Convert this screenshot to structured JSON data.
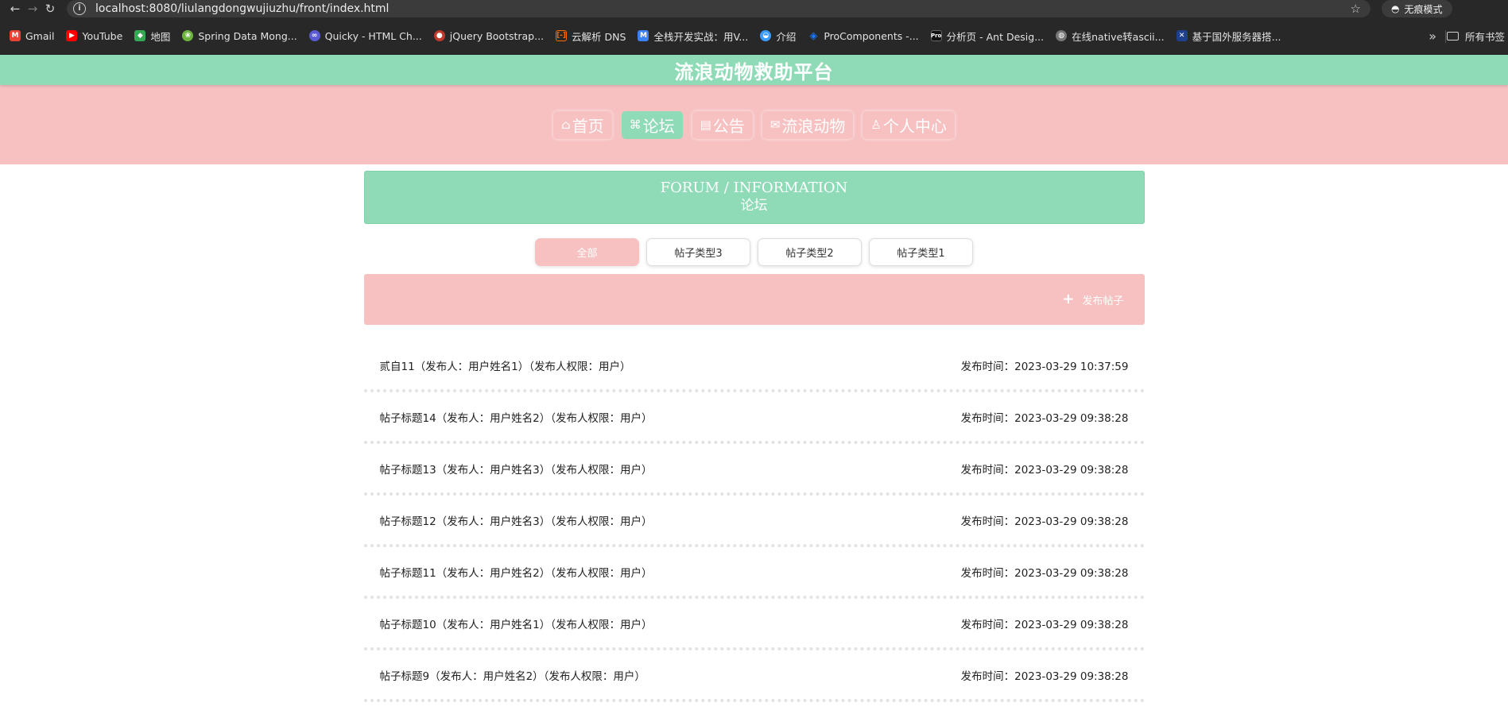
{
  "browser": {
    "url": "localhost:8080/liulangdongwujiuzhu/front/index.html",
    "mode_label": "无痕模式",
    "bookmarks": [
      {
        "label": "Gmail",
        "icon": "gmail-icon",
        "color": "#ea4335"
      },
      {
        "label": "YouTube",
        "icon": "youtube-icon",
        "color": "#ff0000"
      },
      {
        "label": "地图",
        "icon": "maps-icon",
        "color": "#34a853"
      },
      {
        "label": "Spring Data Mong...",
        "icon": "spring-icon",
        "color": "#6db33f"
      },
      {
        "label": "Quicky - HTML Ch...",
        "icon": "quicky-icon",
        "color": "#5b5bd6"
      },
      {
        "label": "jQuery Bootstrap...",
        "icon": "jquery-icon",
        "color": "#c0392b"
      },
      {
        "label": "云解析 DNS",
        "icon": "cloud-dns-icon",
        "color": "#ff6a00"
      },
      {
        "label": "全栈开发实战：用V...",
        "icon": "medium-icon",
        "color": "#3b82f6"
      },
      {
        "label": "介绍",
        "icon": "intro-icon",
        "color": "#3b9cff"
      },
      {
        "label": "ProComponents -...",
        "icon": "antd-icon",
        "color": "#1677ff"
      },
      {
        "label": "分析页 - Ant Desig...",
        "icon": "pro-icon",
        "color": "#111111"
      },
      {
        "label": "在线native转ascii...",
        "icon": "globe-icon",
        "color": "#777777"
      },
      {
        "label": "基于国外服务器搭...",
        "icon": "flag-icon",
        "color": "#1f3f8f"
      }
    ],
    "more_label": "»",
    "folder_label": "所有书签"
  },
  "site": {
    "title": "流浪动物救助平台",
    "nav": [
      {
        "label": "首页",
        "icon": "home-icon",
        "glyph": "⌂",
        "active": false
      },
      {
        "label": "论坛",
        "icon": "forum-icon",
        "glyph": "⌘",
        "active": true
      },
      {
        "label": "公告",
        "icon": "notice-icon",
        "glyph": "▤",
        "active": false
      },
      {
        "label": "流浪动物",
        "icon": "mail-icon",
        "glyph": "✉",
        "active": false
      },
      {
        "label": "个人中心",
        "icon": "user-icon",
        "glyph": "♙",
        "active": false
      }
    ]
  },
  "section": {
    "title_en": "FORUM / INFORMATION",
    "title_cn": "论坛"
  },
  "categories": [
    {
      "label": "全部",
      "active": true
    },
    {
      "label": "帖子类型3",
      "active": false
    },
    {
      "label": "帖子类型2",
      "active": false
    },
    {
      "label": "帖子类型1",
      "active": false
    }
  ],
  "actions": {
    "publish_label": "发布帖子"
  },
  "posts": [
    {
      "title": "贰自11（发布人：用户姓名1）（发布人权限：用户）",
      "time": "发布时间：2023-03-29 10:37:59"
    },
    {
      "title": "帖子标题14（发布人：用户姓名2）（发布人权限：用户）",
      "time": "发布时间：2023-03-29 09:38:28"
    },
    {
      "title": "帖子标题13（发布人：用户姓名3）（发布人权限：用户）",
      "time": "发布时间：2023-03-29 09:38:28"
    },
    {
      "title": "帖子标题12（发布人：用户姓名3）（发布人权限：用户）",
      "time": "发布时间：2023-03-29 09:38:28"
    },
    {
      "title": "帖子标题11（发布人：用户姓名2）（发布人权限：用户）",
      "time": "发布时间：2023-03-29 09:38:28"
    },
    {
      "title": "帖子标题10（发布人：用户姓名1）（发布人权限：用户）",
      "time": "发布时间：2023-03-29 09:38:28"
    },
    {
      "title": "帖子标题9（发布人：用户姓名2）（发布人权限：用户）",
      "time": "发布时间：2023-03-29 09:38:28"
    }
  ],
  "colors": {
    "mint": "#8fdbb7",
    "pink": "#f7c1c2",
    "chrome_dark": "#282828"
  }
}
